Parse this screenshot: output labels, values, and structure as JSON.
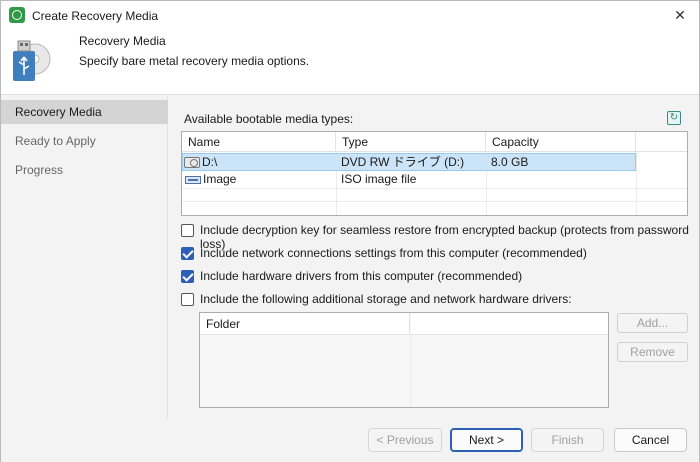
{
  "window": {
    "title": "Create Recovery Media",
    "close_glyph": "✕",
    "app_icon": "veeam-icon"
  },
  "header": {
    "title": "Recovery Media",
    "subtitle": "Specify bare metal recovery media options.",
    "icon": "usb-disc-icon"
  },
  "sidebar": {
    "items": [
      {
        "label": "Recovery Media",
        "active": true
      },
      {
        "label": "Ready to Apply",
        "active": false
      },
      {
        "label": "Progress",
        "active": false
      }
    ]
  },
  "media": {
    "label": "Available bootable media types:",
    "columns": [
      "Name",
      "Type",
      "Capacity"
    ],
    "rows": [
      {
        "name": "D:\\",
        "type": "DVD RW ドライブ (D:)",
        "capacity": "8.0 GB",
        "icon": "drive-icon",
        "selected": true
      },
      {
        "name": "Image",
        "type": "ISO image file",
        "capacity": "",
        "icon": "image-icon",
        "selected": false
      }
    ]
  },
  "options": [
    {
      "label": "Include decryption key for seamless restore from encrypted backup (protects from password loss)",
      "checked": false
    },
    {
      "label": "Include network connections settings from this computer (recommended)",
      "checked": true
    },
    {
      "label": "Include hardware drivers from this computer (recommended)",
      "checked": true
    },
    {
      "label": "Include the following additional storage and network hardware drivers:",
      "checked": false
    }
  ],
  "drivers": {
    "column": "Folder",
    "add_label": "Add...",
    "remove_label": "Remove"
  },
  "footer": {
    "previous_label": "< Previous",
    "next_label": "Next >",
    "finish_label": "Finish",
    "cancel_label": "Cancel"
  },
  "colors": {
    "accent": "#2b5fb8",
    "selection": "#cce4f7",
    "sidebar_active": "#d4d4d4"
  }
}
